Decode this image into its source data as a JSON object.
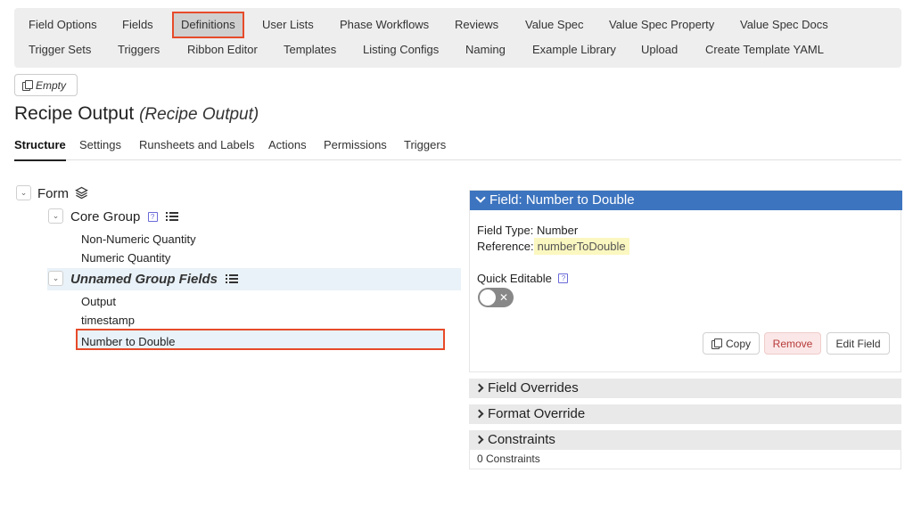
{
  "nav": {
    "row1": [
      "Field Options",
      "Fields",
      "Definitions",
      "User Lists",
      "Phase Workflows",
      "Reviews",
      "Value Spec",
      "Value Spec Property",
      "Value Spec Docs"
    ],
    "row2": [
      "Trigger Sets",
      "Triggers",
      "Ribbon Editor",
      "Templates",
      "Listing Configs",
      "Naming",
      "Example Library",
      "Upload",
      "Create Template YAML"
    ],
    "active": "Definitions"
  },
  "empty_button": {
    "label": "Empty",
    "icon": "copy-icon"
  },
  "page": {
    "title": "Recipe Output",
    "subtitle": "(Recipe Output)"
  },
  "tabs": [
    "Structure",
    "Settings",
    "Runsheets and Labels",
    "Actions",
    "Permissions",
    "Triggers"
  ],
  "active_tab": "Structure",
  "tree": {
    "form_label": "Form",
    "form_icon": "layers-icon",
    "core_group": {
      "label": "Core Group",
      "help": "?",
      "fields": [
        "Non-Numeric Quantity",
        "Numeric Quantity"
      ]
    },
    "unnamed_group": {
      "label": "Unnamed Group Fields",
      "fields": [
        "Output",
        "timestamp",
        "Number to Double"
      ]
    },
    "selected_field": "Number to Double"
  },
  "field_panel": {
    "header": "Field: Number to Double",
    "field_type_label": "Field Type:",
    "field_type": "Number",
    "reference_label": "Reference:",
    "reference": "numberToDouble",
    "quick_editable_label": "Quick Editable",
    "help": "?",
    "toggle_mark": "✕",
    "quick_editable_on": false,
    "buttons": {
      "copy": "Copy",
      "remove": "Remove",
      "edit": "Edit Field"
    }
  },
  "sections": {
    "field_overrides": "Field Overrides",
    "format_override": "Format Override",
    "constraints": "Constraints"
  },
  "constraints_count_text": "0 Constraints",
  "colors": {
    "accent": "#3d74bf",
    "highlight_border": "#e74a2a",
    "selection_bg": "#e9f2f8",
    "reference_bg": "#fbf7c0"
  }
}
